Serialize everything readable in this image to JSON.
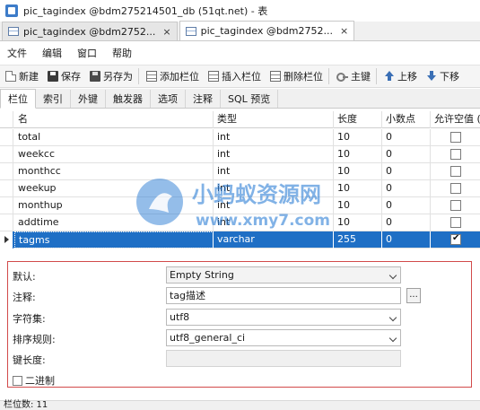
{
  "window": {
    "title": "pic_tagindex @bdm275214501_db (51qt.net) - 表"
  },
  "doc_tabs": [
    {
      "label": "pic_tagindex @bdm2752...",
      "close": "×"
    },
    {
      "label": "pic_tagindex @bdm2752...",
      "close": "×"
    }
  ],
  "menu": [
    "文件",
    "编辑",
    "窗口",
    "帮助"
  ],
  "toolbar": {
    "new": "新建",
    "save": "保存",
    "save_as": "另存为",
    "add_field": "添加栏位",
    "insert_field": "插入栏位",
    "delete_field": "删除栏位",
    "primary_key": "主键",
    "move_up": "上移",
    "move_down": "下移"
  },
  "subtabs": [
    "栏位",
    "索引",
    "外键",
    "触发器",
    "选项",
    "注释",
    "SQL 预览"
  ],
  "grid": {
    "headers": [
      "名",
      "类型",
      "长度",
      "小数点",
      "允许空值 ("
    ],
    "rows": [
      {
        "name": "total",
        "type": "int",
        "length": "10",
        "decimals": "0",
        "nullable": false
      },
      {
        "name": "weekcc",
        "type": "int",
        "length": "10",
        "decimals": "0",
        "nullable": false
      },
      {
        "name": "monthcc",
        "type": "int",
        "length": "10",
        "decimals": "0",
        "nullable": false
      },
      {
        "name": "weekup",
        "type": "int",
        "length": "10",
        "decimals": "0",
        "nullable": false
      },
      {
        "name": "monthup",
        "type": "int",
        "length": "10",
        "decimals": "0",
        "nullable": false
      },
      {
        "name": "addtime",
        "type": "int",
        "length": "10",
        "decimals": "0",
        "nullable": false
      },
      {
        "name": "tagms",
        "type": "varchar",
        "length": "255",
        "decimals": "0",
        "nullable": true
      }
    ],
    "selected_row": 6
  },
  "properties": {
    "default_label": "默认:",
    "default_value": "Empty String",
    "comment_label": "注释:",
    "comment_value": "tag描述",
    "comment_button": "...",
    "charset_label": "字符集:",
    "charset_value": "utf8",
    "collation_label": "排序规则:",
    "collation_value": "utf8_general_ci",
    "key_length_label": "键长度:",
    "key_length_value": "",
    "binary_label": "二进制"
  },
  "statusbar": {
    "text": "栏位数: 11"
  },
  "watermark": {
    "line1": "小蚂蚁资源网",
    "line2": "www.xmy7.com"
  },
  "colors": {
    "selection": "#1f6fc5",
    "accent_border": "#d24a4a",
    "watermark": "#2f7fd6"
  }
}
